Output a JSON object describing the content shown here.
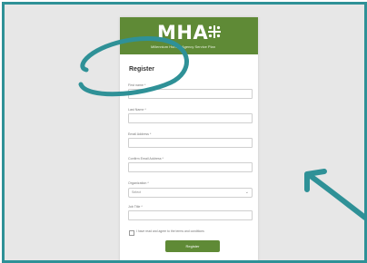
{
  "colors": {
    "teal": "#2f9197",
    "brand_green": "#5f8a36"
  },
  "brand": {
    "logo_text": "MHA",
    "logo_mark_icon": "cross-dots-icon",
    "tagline": "Millennium Human Agency Service Plan"
  },
  "form": {
    "title": "Register",
    "fields": [
      {
        "label": "First name *"
      },
      {
        "label": "Last Name *"
      },
      {
        "label": "Email Address *"
      },
      {
        "label": "Confirm Email Address *"
      },
      {
        "label": "Organization *",
        "placeholder": "Select"
      },
      {
        "label": "Job Title *"
      }
    ],
    "checkbox_label": "I have read and agree to the terms and conditions",
    "submit_label": "Register"
  }
}
